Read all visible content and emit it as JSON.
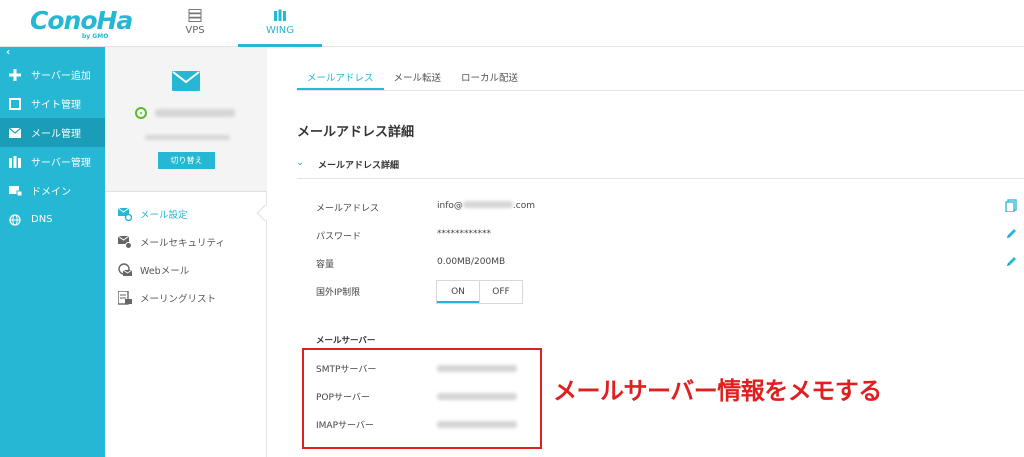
{
  "brand": {
    "logo": "ConoHa",
    "logo_sub": "by GMO"
  },
  "topnav": {
    "tabs": [
      {
        "label": "VPS"
      },
      {
        "label": "WING"
      }
    ]
  },
  "sidebar": {
    "collapse": "‹",
    "items": [
      {
        "label": "サーバー追加",
        "icon": "plus-icon"
      },
      {
        "label": "サイト管理",
        "icon": "site-icon"
      },
      {
        "label": "メール管理",
        "icon": "mail-icon"
      },
      {
        "label": "サーバー管理",
        "icon": "server-icon"
      },
      {
        "label": "ドメイン",
        "icon": "domain-icon"
      },
      {
        "label": "DNS",
        "icon": "globe-icon"
      }
    ]
  },
  "subpanel": {
    "switch_label": "切り替え",
    "items": [
      {
        "label": "メール設定"
      },
      {
        "label": "メールセキュリティ"
      },
      {
        "label": "Webメール"
      },
      {
        "label": "メーリングリスト"
      }
    ]
  },
  "main": {
    "tabs": [
      {
        "label": "メールアドレス"
      },
      {
        "label": "メール転送"
      },
      {
        "label": "ローカル配送"
      }
    ],
    "section_title": "メールアドレス詳細",
    "accordion_title": "メールアドレス詳細",
    "rows": {
      "address": {
        "label": "メールアドレス",
        "value_prefix": "info@",
        "value_suffix": ".com"
      },
      "password": {
        "label": "パスワード",
        "value": "************"
      },
      "capacity": {
        "label": "容量",
        "value": "0.00MB/200MB"
      },
      "foreign_ip": {
        "label": "国外IP制限",
        "on": "ON",
        "off": "OFF"
      }
    },
    "mail_server": {
      "title": "メールサーバー",
      "smtp_label": "SMTPサーバー",
      "pop_label": "POPサーバー",
      "imap_label": "IMAPサーバー"
    },
    "annotation": "メールサーバー情報をメモする"
  },
  "colors": {
    "accent": "#25b7d3",
    "accent_dark": "#1a9db8",
    "annotation_red": "#e02020"
  }
}
